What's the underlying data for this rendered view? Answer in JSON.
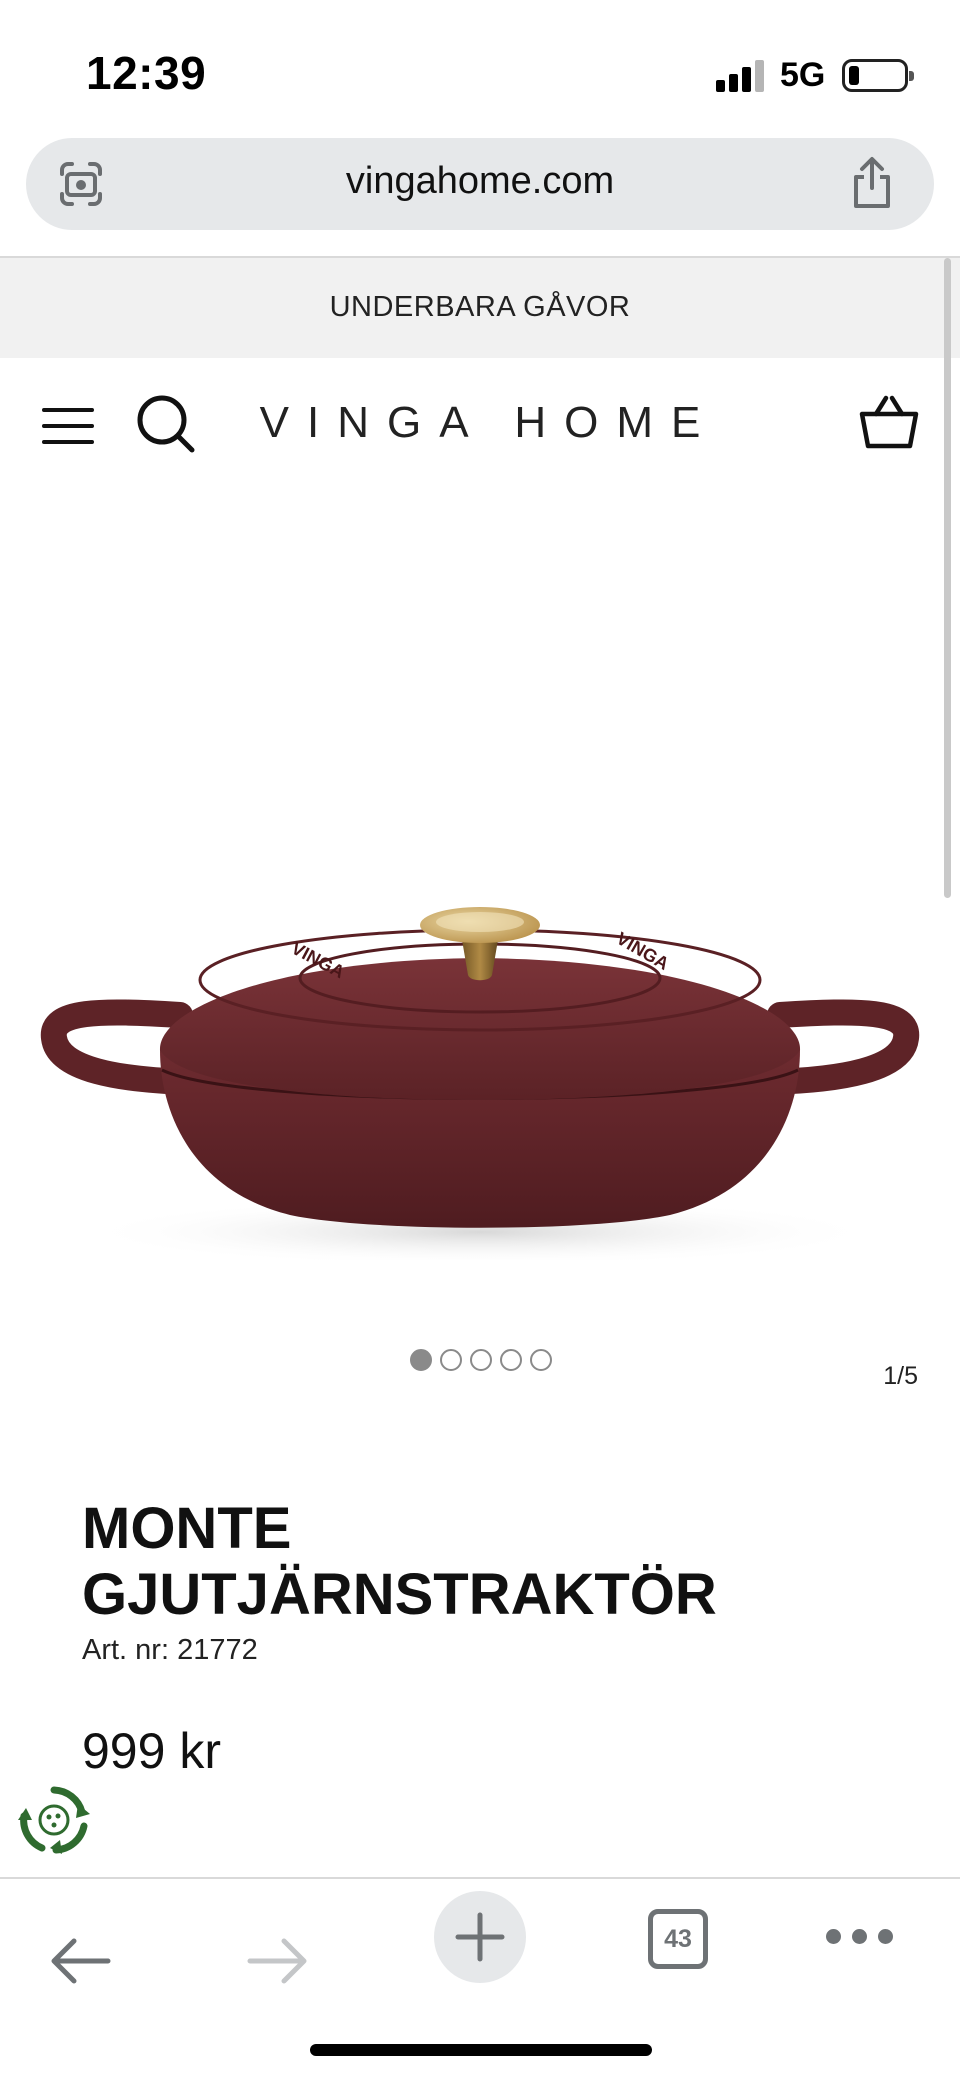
{
  "status_bar": {
    "time": "12:39",
    "network": "5G",
    "icons": [
      "signal-icon",
      "battery-icon"
    ]
  },
  "browser": {
    "url": "vingahome.com",
    "icons": [
      "lens-icon",
      "share-icon"
    ]
  },
  "announcement": {
    "text": "UNDERBARA GÅVOR"
  },
  "header": {
    "brand": "VINGA HOME",
    "icons": [
      "menu-icon",
      "search-icon",
      "cart-icon"
    ]
  },
  "product": {
    "image_alt": "Monte cast iron braiser, burgundy with gold knob",
    "lid_embossing": "VINGA",
    "carousel": {
      "total": 5,
      "active_index": 0,
      "counter": "1/5"
    },
    "title": "MONTE GJUTJÄRNSTRAKTÖR",
    "article_number": "Art. nr: 21772",
    "price": "999 kr",
    "colors": {
      "pot": "#6b2a2e",
      "knob": "#c9a55e"
    }
  },
  "toolbar": {
    "tabs_count": "43",
    "icons": [
      "back-arrow-icon",
      "forward-arrow-icon",
      "plus-icon",
      "tabs-icon",
      "more-icon"
    ]
  },
  "eco_badge": {
    "icon": "recycle-icon"
  }
}
